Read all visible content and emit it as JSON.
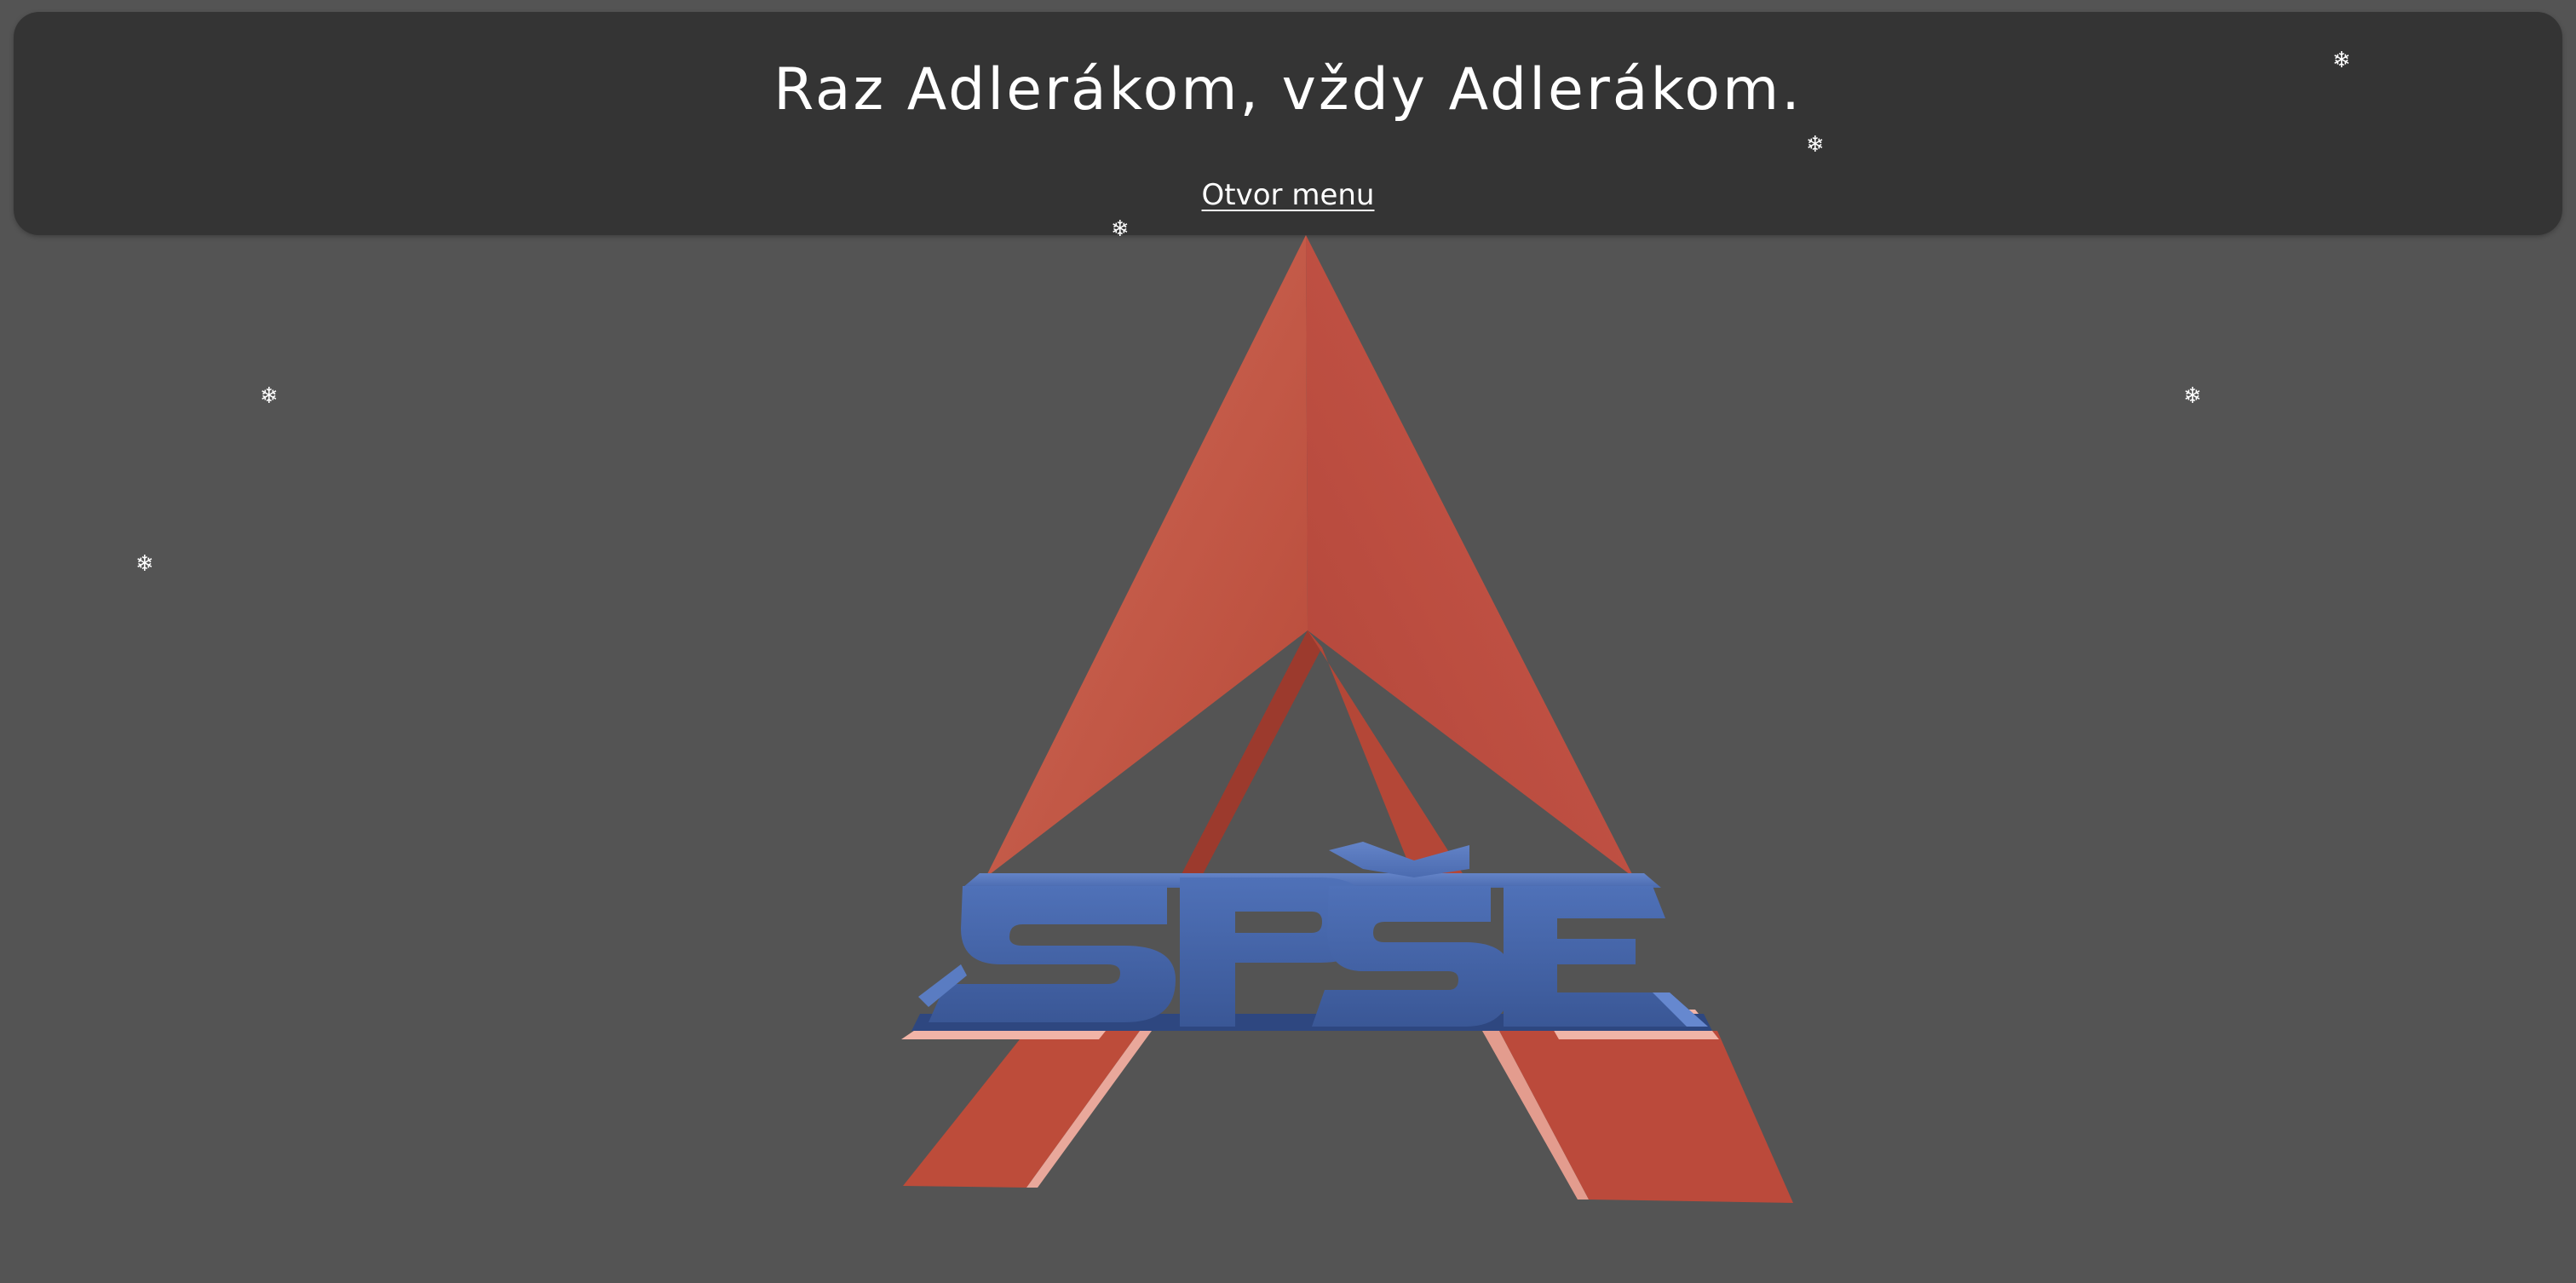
{
  "header": {
    "title": "Raz Adlerákom, vždy Adlerákom.",
    "menu_link": "Otvor menu"
  },
  "logo": {
    "text": "SPŠE",
    "colors": {
      "red": "#c0513f",
      "blue": "#3f5fa5"
    }
  },
  "decorations": {
    "snowflake_glyph": "❄"
  },
  "colors": {
    "page_background": "#545454",
    "header_background": "#343434",
    "text": "#ffffff"
  }
}
